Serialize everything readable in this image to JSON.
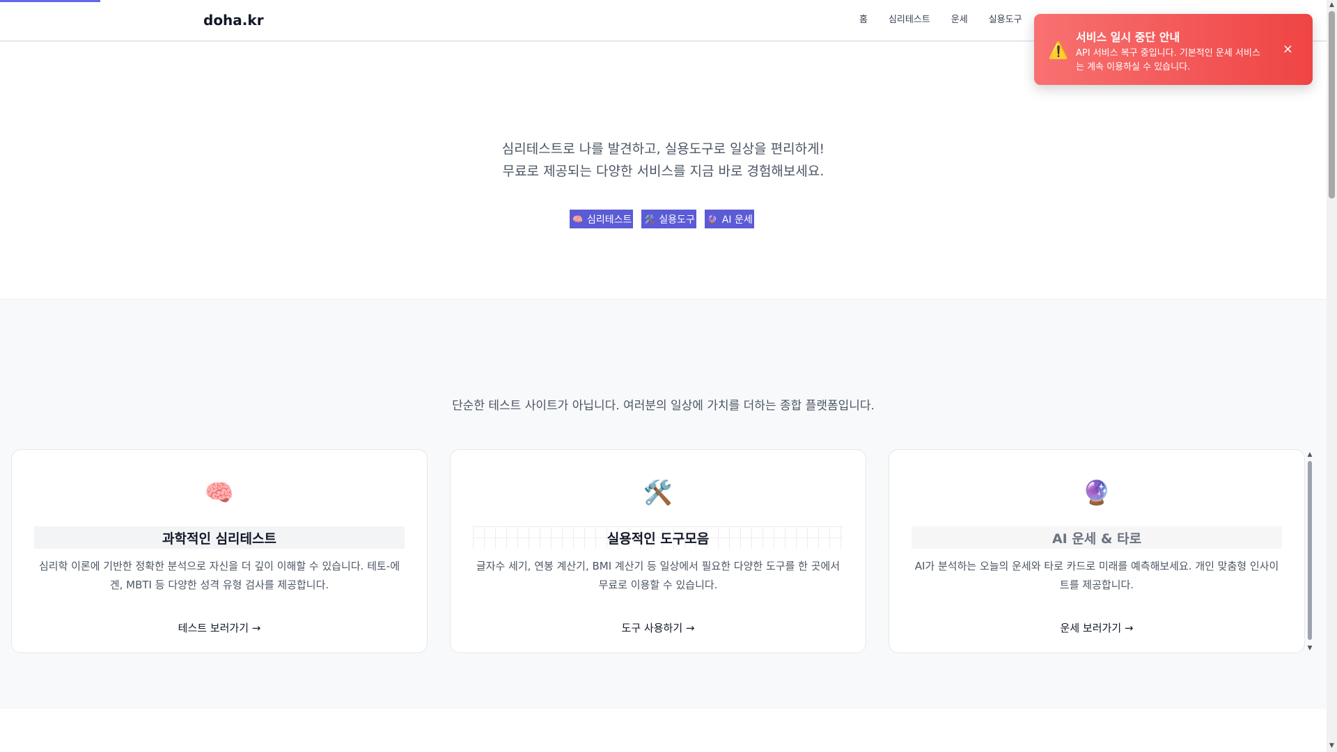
{
  "header": {
    "logo": "doha.kr",
    "nav": [
      "홈",
      "심리테스트",
      "운세",
      "실용도구"
    ]
  },
  "hero": {
    "line1": "심리테스트로 나를 발견하고, 실용도구로 일상을 편리하게!",
    "line2": "무료로 제공되는 다양한 서비스를 지금 바로 경험해보세요.",
    "buttons": [
      {
        "emoji": "🧠",
        "label": "심리테스트"
      },
      {
        "emoji": "🛠️",
        "label": "실용도구"
      },
      {
        "emoji": "🔮",
        "label": "AI 운세"
      }
    ]
  },
  "features": {
    "description": "단순한 테스트 사이트가 아닙니다. 여러분의 일상에 가치를 더하는 종합 플랫폼입니다.",
    "cards": [
      {
        "icon": "🧠",
        "title": "과학적인 심리테스트",
        "text": "심리학 이론에 기반한 정확한 분석으로 자신을 더 깊이 이해할 수 있습니다. 테토-에겐, MBTI 등 다양한 성격 유형 검사를 제공합니다.",
        "link": "테스트 보러가기 →"
      },
      {
        "icon": "🛠️",
        "title": "실용적인 도구모음",
        "text": "글자수 세기, 연봉 계산기, BMI 계산기 등 일상에서 필요한 다양한 도구를 한 곳에서 무료로 이용할 수 있습니다.",
        "link": "도구 사용하기 →"
      },
      {
        "icon": "🔮",
        "title": "AI 운세 & 타로",
        "text": "AI가 분석하는 오늘의 운세와 타로 카드로 미래를 예측해보세요. 개인 맞춤형 인사이트를 제공합니다.",
        "link": "운세 보러가기 →"
      }
    ]
  },
  "toast": {
    "icon": "⚠️",
    "title": "서비스 일시 중단 안내",
    "message": "API 서비스 복구 중입니다. 기본적인 운세 서비스는 계속 이용하실 수 있습니다.",
    "close": "×"
  },
  "colors": {
    "accent": "#5b5bd6",
    "toast_from": "#f87171",
    "toast_to": "#ef4444"
  }
}
